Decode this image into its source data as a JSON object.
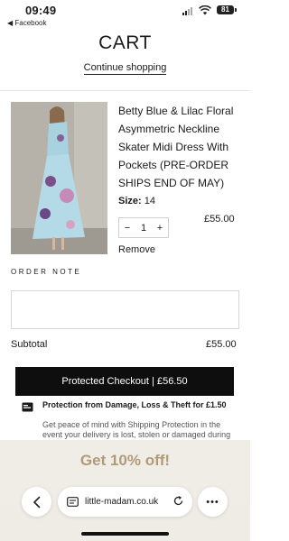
{
  "status_bar": {
    "time": "09:49",
    "back_app": "◀ Facebook",
    "battery": "81"
  },
  "header": {
    "title": "CART",
    "continue_label": "Continue shopping"
  },
  "item": {
    "name": "Betty Blue & Lilac Floral Asymmetric Neckline Skater Midi Dress With Pockets (PRE-ORDER SHIPS END OF MAY)",
    "size_label": "Size:",
    "size_value": "14",
    "price": "£55.00",
    "quantity": "1",
    "minus": "−",
    "plus": "+",
    "remove_label": "Remove"
  },
  "order_note": {
    "label": "ORDER NOTE",
    "value": ""
  },
  "summary": {
    "subtotal_label": "Subtotal",
    "subtotal_value": "£55.00"
  },
  "checkout": {
    "label": "Protected Checkout | £56.50"
  },
  "protection": {
    "title": "Protection from Damage, Loss & Theft for £1.50",
    "body": "Get peace of mind with Shipping Protection in the event your delivery is lost, stolen or damaged during transit or delivery"
  },
  "promo": {
    "label": "Get 10% off!"
  },
  "browser": {
    "url": "little-madam.co.uk",
    "menu_label": "•••"
  },
  "colors": {
    "promo_text": "#b09b78",
    "checkout_bg": "#0e0e0e"
  }
}
